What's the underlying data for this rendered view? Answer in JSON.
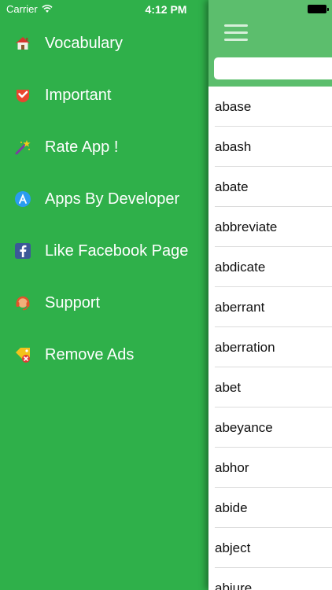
{
  "status": {
    "carrier": "Carrier",
    "time": "4:12 PM"
  },
  "menu": {
    "items": [
      {
        "label": "Vocabulary",
        "icon": "home-icon"
      },
      {
        "label": "Important",
        "icon": "important-check-icon"
      },
      {
        "label": "Rate App !",
        "icon": "magic-wand-icon"
      },
      {
        "label": "Apps By Developer",
        "icon": "app-store-icon"
      },
      {
        "label": "Like Facebook Page",
        "icon": "facebook-icon"
      },
      {
        "label": "Support",
        "icon": "support-headset-icon"
      },
      {
        "label": "Remove Ads",
        "icon": "remove-ads-tag-icon"
      }
    ]
  },
  "search": {
    "value": "",
    "placeholder": ""
  },
  "words": [
    "abase",
    "abash",
    "abate",
    "abbreviate",
    "abdicate",
    "aberrant",
    "aberration",
    "abet",
    "abeyance",
    "abhor",
    "abide",
    "abject",
    "abjure"
  ],
  "colors": {
    "menu_background": "#2fb04a",
    "header_background": "#5cbe6d",
    "list_background": "#ffffff"
  }
}
